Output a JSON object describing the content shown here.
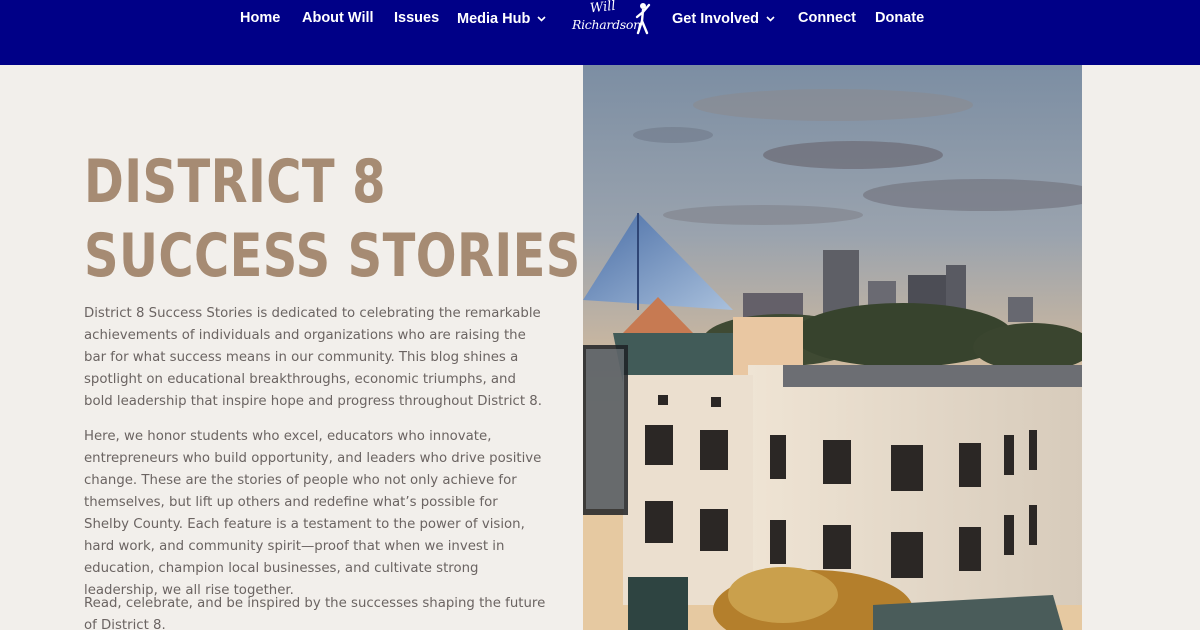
{
  "nav": {
    "items": [
      {
        "label": "Home",
        "dropdown": false
      },
      {
        "label": "About Will",
        "dropdown": false
      },
      {
        "label": "Issues",
        "dropdown": false
      },
      {
        "label": "Media Hub",
        "dropdown": true
      },
      {
        "label": "Get Involved",
        "dropdown": true
      },
      {
        "label": "Connect",
        "dropdown": false
      },
      {
        "label": "Donate",
        "dropdown": false
      }
    ],
    "logo": {
      "line1": "Will",
      "line2": "Richardson"
    },
    "background": "#000087"
  },
  "hero": {
    "title_line1": "DISTRICT 8",
    "title_line2": "SUCCESS STORIES",
    "title_color": "#a68b73",
    "paragraphs": [
      "District 8 Success Stories is dedicated to celebrating the remarkable achievements of individuals and organizations who are raising the bar for what success means in our community. This blog shines a spotlight on educational breakthroughs, economic triumphs, and bold leadership that inspire hope and progress throughout District 8.",
      "Here, we honor students who excel, educators who innovate, entrepreneurs who build opportunity, and leaders who drive positive change. These are the stories of people who not only achieve for themselves, but lift up others and redefine what’s possible for Shelby County. Each feature is a testament to the power of vision, hard work, and community spirit—proof that when we invest in education, champion local businesses, and cultivate strong leadership, we all rise together.",
      "Read, celebrate, and be inspired by the successes shaping the future of District 8."
    ]
  },
  "colors": {
    "page_bg": "#f2efeb",
    "body_text": "#6b6462"
  }
}
